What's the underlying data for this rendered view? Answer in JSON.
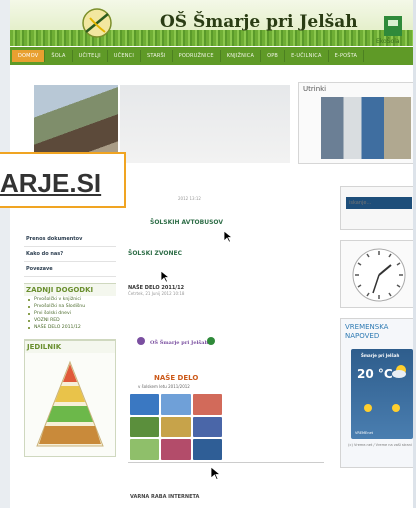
{
  "header": {
    "title": "OŠ Šmarje pri Jelšah",
    "eko_label": "EkoŠola"
  },
  "nav": {
    "items": [
      "DOMOV",
      "ŠOLA",
      "UČITELJI",
      "UČENCI",
      "STARŠI",
      "PODRUŽNICE",
      "KNJIŽNICA",
      "OPB",
      "E-UČILNICA",
      "E-POŠTA"
    ],
    "active": "DOMOV"
  },
  "gallery": {
    "right_title": "Utrinki"
  },
  "callout": {
    "text": "ARJE.SI"
  },
  "left": {
    "links": [
      "Prenos dokumentov",
      "Kako do nas?",
      "Povezave"
    ],
    "events_title": "ZADNJI DOGODKI",
    "events": [
      "Prvošolčki v knjižnici",
      "Prvošolčki na Slodišnu",
      "Prvi šolski dnevi",
      "VOZNI RED",
      "NAŠE DELO 2011/12"
    ],
    "menu_title": "JEDILNIK"
  },
  "main": {
    "meta1": "2012 13:12",
    "title1": "ŠOLSKIH AVTOBUSOV",
    "title2": "ŠOLSKI ZVONEC",
    "head3": "NAŠE DELO 2011/12",
    "meta3": "Četrtek, 21 Junij 2012 10:18",
    "poster_school": "OŠ Šmarje pri Jelšah",
    "poster_title": "NAŠE DELO",
    "poster_sub": "v šolskem letu 2011/2012",
    "head4": "VARNA RABA INTERNETA"
  },
  "right": {
    "search_placeholder": "iskanje...",
    "weather_title": "VREMENSKA NAPOVED",
    "widget_name": "Šmarje pri Jelšah",
    "temperature": "20 °C",
    "widget_foot": "VREMEnet",
    "weather_link": "(c) Vreme.net / Vreme na vaši strani"
  },
  "colors": {
    "nav": "#5f9a27",
    "active": "#e8a030",
    "callout_border": "#f0a422",
    "green_text": "#2f6e48"
  }
}
